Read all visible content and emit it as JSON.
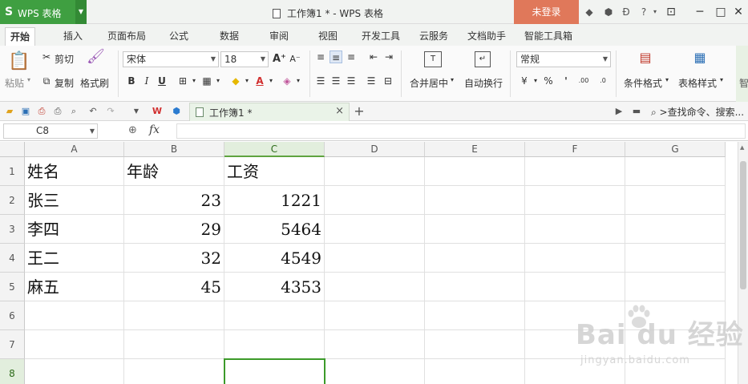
{
  "app": {
    "logo": "S",
    "name": "WPS 表格",
    "doc_title": "工作簿1 * - WPS 表格",
    "login": "未登录"
  },
  "tabs": [
    "开始",
    "插入",
    "页面布局",
    "公式",
    "数据",
    "审阅",
    "视图",
    "开发工具",
    "云服务",
    "文档助手",
    "智能工具箱"
  ],
  "ribbon": {
    "paste": "粘贴",
    "cut": "剪切",
    "copy": "复制",
    "format_painter": "格式刷",
    "font_name": "宋体",
    "font_size": "18",
    "merge_center": "合并居中",
    "wrap_text": "自动换行",
    "number_format": "常规",
    "conditional_format": "条件格式",
    "table_style": "表格样式",
    "smart": "智",
    "bold": "B",
    "italic": "I",
    "underline": "U",
    "percent": "%",
    "comma": "'",
    "inc_decimal": ".00",
    "dec_decimal": ".0",
    "font_grow": "A⁺",
    "font_shrink": "A⁻"
  },
  "qbar": {
    "doc_tab": "工作簿1 *",
    "search": ">查找命令、搜索..."
  },
  "formula_bar": {
    "name_box": "C8",
    "fx": "fx",
    "value": ""
  },
  "grid": {
    "columns": [
      "A",
      "B",
      "C",
      "D",
      "E",
      "F",
      "G"
    ],
    "rows": [
      "1",
      "2",
      "3",
      "4",
      "5",
      "6",
      "7",
      "8"
    ],
    "selected_cell": "C8",
    "cells": [
      [
        "姓名",
        "年龄",
        "工资"
      ],
      [
        "张三",
        "23",
        "1221"
      ],
      [
        "李四",
        "29",
        "5464"
      ],
      [
        "王二",
        "32",
        "4549"
      ],
      [
        "麻五",
        "45",
        "4353"
      ]
    ]
  },
  "watermark": {
    "main": "Bai  du 经验",
    "sub": "jingyan.baidu.com"
  }
}
